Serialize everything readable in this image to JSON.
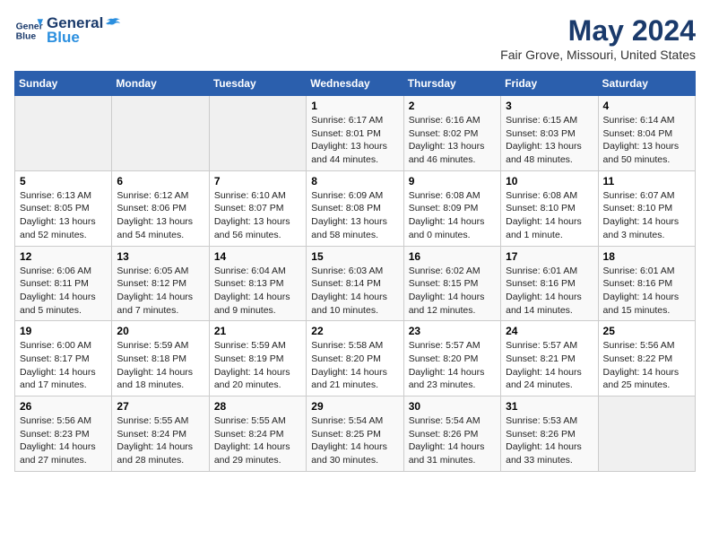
{
  "header": {
    "logo_line1": "General",
    "logo_line2": "Blue",
    "title": "May 2024",
    "subtitle": "Fair Grove, Missouri, United States"
  },
  "weekdays": [
    "Sunday",
    "Monday",
    "Tuesday",
    "Wednesday",
    "Thursday",
    "Friday",
    "Saturday"
  ],
  "weeks": [
    [
      {
        "day": "",
        "empty": true
      },
      {
        "day": "",
        "empty": true
      },
      {
        "day": "",
        "empty": true
      },
      {
        "day": "1",
        "sunrise": "6:17 AM",
        "sunset": "8:01 PM",
        "daylight": "13 hours and 44 minutes."
      },
      {
        "day": "2",
        "sunrise": "6:16 AM",
        "sunset": "8:02 PM",
        "daylight": "13 hours and 46 minutes."
      },
      {
        "day": "3",
        "sunrise": "6:15 AM",
        "sunset": "8:03 PM",
        "daylight": "13 hours and 48 minutes."
      },
      {
        "day": "4",
        "sunrise": "6:14 AM",
        "sunset": "8:04 PM",
        "daylight": "13 hours and 50 minutes."
      }
    ],
    [
      {
        "day": "5",
        "sunrise": "6:13 AM",
        "sunset": "8:05 PM",
        "daylight": "13 hours and 52 minutes."
      },
      {
        "day": "6",
        "sunrise": "6:12 AM",
        "sunset": "8:06 PM",
        "daylight": "13 hours and 54 minutes."
      },
      {
        "day": "7",
        "sunrise": "6:10 AM",
        "sunset": "8:07 PM",
        "daylight": "13 hours and 56 minutes."
      },
      {
        "day": "8",
        "sunrise": "6:09 AM",
        "sunset": "8:08 PM",
        "daylight": "13 hours and 58 minutes."
      },
      {
        "day": "9",
        "sunrise": "6:08 AM",
        "sunset": "8:09 PM",
        "daylight": "14 hours and 0 minutes."
      },
      {
        "day": "10",
        "sunrise": "6:08 AM",
        "sunset": "8:10 PM",
        "daylight": "14 hours and 1 minute."
      },
      {
        "day": "11",
        "sunrise": "6:07 AM",
        "sunset": "8:10 PM",
        "daylight": "14 hours and 3 minutes."
      }
    ],
    [
      {
        "day": "12",
        "sunrise": "6:06 AM",
        "sunset": "8:11 PM",
        "daylight": "14 hours and 5 minutes."
      },
      {
        "day": "13",
        "sunrise": "6:05 AM",
        "sunset": "8:12 PM",
        "daylight": "14 hours and 7 minutes."
      },
      {
        "day": "14",
        "sunrise": "6:04 AM",
        "sunset": "8:13 PM",
        "daylight": "14 hours and 9 minutes."
      },
      {
        "day": "15",
        "sunrise": "6:03 AM",
        "sunset": "8:14 PM",
        "daylight": "14 hours and 10 minutes."
      },
      {
        "day": "16",
        "sunrise": "6:02 AM",
        "sunset": "8:15 PM",
        "daylight": "14 hours and 12 minutes."
      },
      {
        "day": "17",
        "sunrise": "6:01 AM",
        "sunset": "8:16 PM",
        "daylight": "14 hours and 14 minutes."
      },
      {
        "day": "18",
        "sunrise": "6:01 AM",
        "sunset": "8:16 PM",
        "daylight": "14 hours and 15 minutes."
      }
    ],
    [
      {
        "day": "19",
        "sunrise": "6:00 AM",
        "sunset": "8:17 PM",
        "daylight": "14 hours and 17 minutes."
      },
      {
        "day": "20",
        "sunrise": "5:59 AM",
        "sunset": "8:18 PM",
        "daylight": "14 hours and 18 minutes."
      },
      {
        "day": "21",
        "sunrise": "5:59 AM",
        "sunset": "8:19 PM",
        "daylight": "14 hours and 20 minutes."
      },
      {
        "day": "22",
        "sunrise": "5:58 AM",
        "sunset": "8:20 PM",
        "daylight": "14 hours and 21 minutes."
      },
      {
        "day": "23",
        "sunrise": "5:57 AM",
        "sunset": "8:20 PM",
        "daylight": "14 hours and 23 minutes."
      },
      {
        "day": "24",
        "sunrise": "5:57 AM",
        "sunset": "8:21 PM",
        "daylight": "14 hours and 24 minutes."
      },
      {
        "day": "25",
        "sunrise": "5:56 AM",
        "sunset": "8:22 PM",
        "daylight": "14 hours and 25 minutes."
      }
    ],
    [
      {
        "day": "26",
        "sunrise": "5:56 AM",
        "sunset": "8:23 PM",
        "daylight": "14 hours and 27 minutes."
      },
      {
        "day": "27",
        "sunrise": "5:55 AM",
        "sunset": "8:24 PM",
        "daylight": "14 hours and 28 minutes."
      },
      {
        "day": "28",
        "sunrise": "5:55 AM",
        "sunset": "8:24 PM",
        "daylight": "14 hours and 29 minutes."
      },
      {
        "day": "29",
        "sunrise": "5:54 AM",
        "sunset": "8:25 PM",
        "daylight": "14 hours and 30 minutes."
      },
      {
        "day": "30",
        "sunrise": "5:54 AM",
        "sunset": "8:26 PM",
        "daylight": "14 hours and 31 minutes."
      },
      {
        "day": "31",
        "sunrise": "5:53 AM",
        "sunset": "8:26 PM",
        "daylight": "14 hours and 33 minutes."
      },
      {
        "day": "",
        "empty": true
      }
    ]
  ],
  "colors": {
    "header_bg": "#2b5fad",
    "logo_color": "#1a3a6b"
  }
}
